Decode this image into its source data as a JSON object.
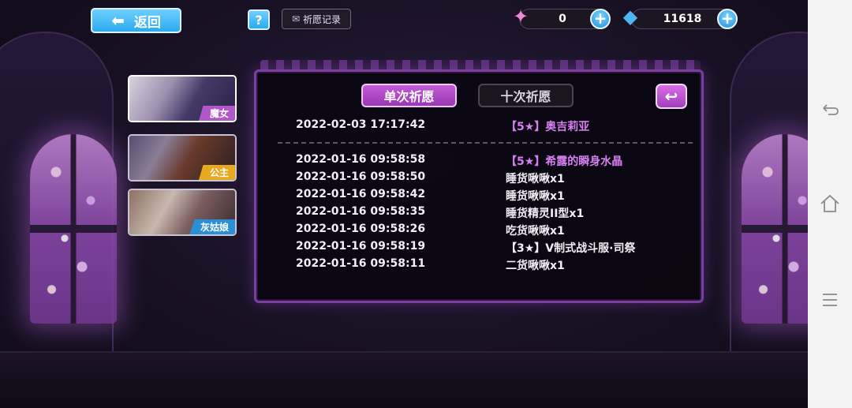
{
  "top_bar": {
    "back_label": "返回",
    "help_label": "?",
    "record_label": "祈愿记录",
    "currency_gem": {
      "icon": "pink-crystal-icon",
      "value": "0"
    },
    "currency_diamond": {
      "icon": "blue-diamond-icon",
      "value": "11618"
    },
    "plus_label": "+"
  },
  "characters": [
    {
      "tag": "魔女",
      "tag_color": "#b257c9"
    },
    {
      "tag": "公主",
      "tag_color": "#e7a91f"
    },
    {
      "tag": "灰姑娘",
      "tag_color": "#2b8fd8"
    }
  ],
  "tabs": {
    "single": "单次祈愿",
    "ten": "十次祈愿",
    "return_icon": "↩"
  },
  "records_top": [
    {
      "time": "2022-02-03 17:17:42",
      "item": "【5★】奥吉莉亚",
      "rarity": 5
    }
  ],
  "records": [
    {
      "time": "2022-01-16 09:58:58",
      "item": "【5★】希露的瞬身水晶",
      "rarity": 5
    },
    {
      "time": "2022-01-16 09:58:50",
      "item": "睡货啾啾x1",
      "rarity": 0
    },
    {
      "time": "2022-01-16 09:58:42",
      "item": "睡货啾啾x1",
      "rarity": 0
    },
    {
      "time": "2022-01-16 09:58:35",
      "item": "睡货精灵II型x1",
      "rarity": 0
    },
    {
      "time": "2022-01-16 09:58:26",
      "item": "吃货啾啾x1",
      "rarity": 0
    },
    {
      "time": "2022-01-16 09:58:19",
      "item": "【3★】V制式战斗服·司祭",
      "rarity": 3
    },
    {
      "time": "2022-01-16 09:58:11",
      "item": "二货啾啾x1",
      "rarity": 0
    }
  ],
  "colors": {
    "accent_purple": "#9a38b4",
    "five_star": "#d67ff0",
    "button_blue": "#2ba9ef"
  },
  "navbar": {
    "back_icon": "back-icon",
    "home_icon": "home-icon",
    "menu_icon": "menu-icon"
  }
}
